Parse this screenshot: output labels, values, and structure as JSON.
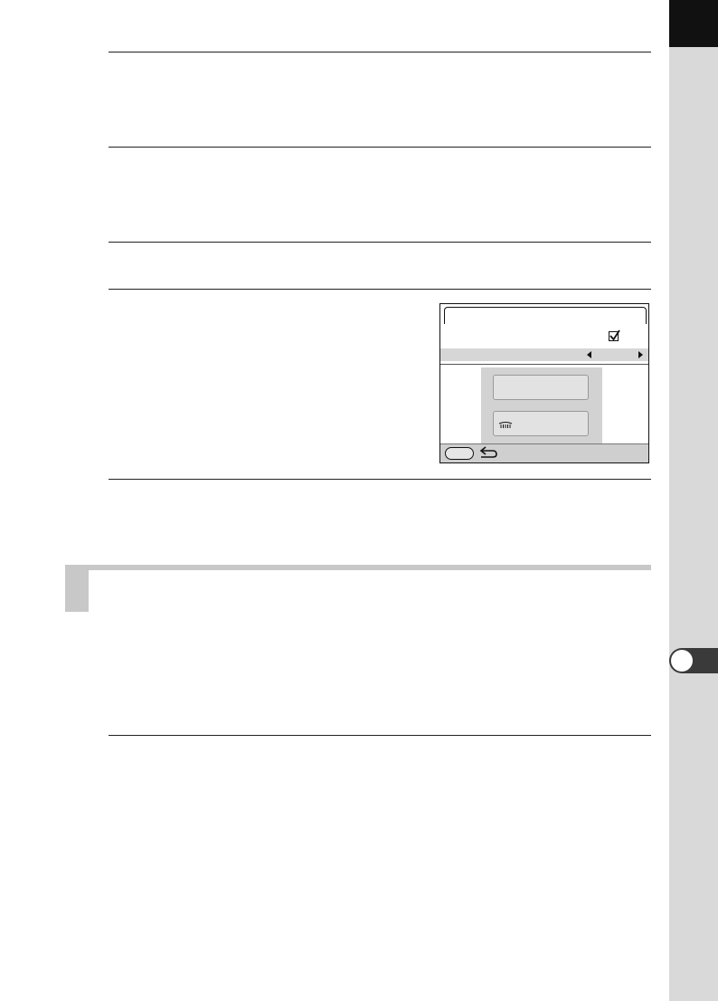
{
  "page": {
    "background": "#ffffff",
    "rule_color": "#222222"
  },
  "side_tab": {
    "color": "#d9d9d9",
    "header_color": "#111111",
    "chapter_marker_color": "#3a3a3a"
  },
  "section_header": {
    "color": "#c8c8c8"
  },
  "camera_screen": {
    "checkbox_checked": true,
    "icons": [
      "check-icon",
      "arrow-left-icon",
      "arrow-right-icon",
      "dial-icon",
      "back-arrow-icon"
    ],
    "footer_color": "#cfcfcf",
    "dialog_color": "#d2d2d2"
  }
}
